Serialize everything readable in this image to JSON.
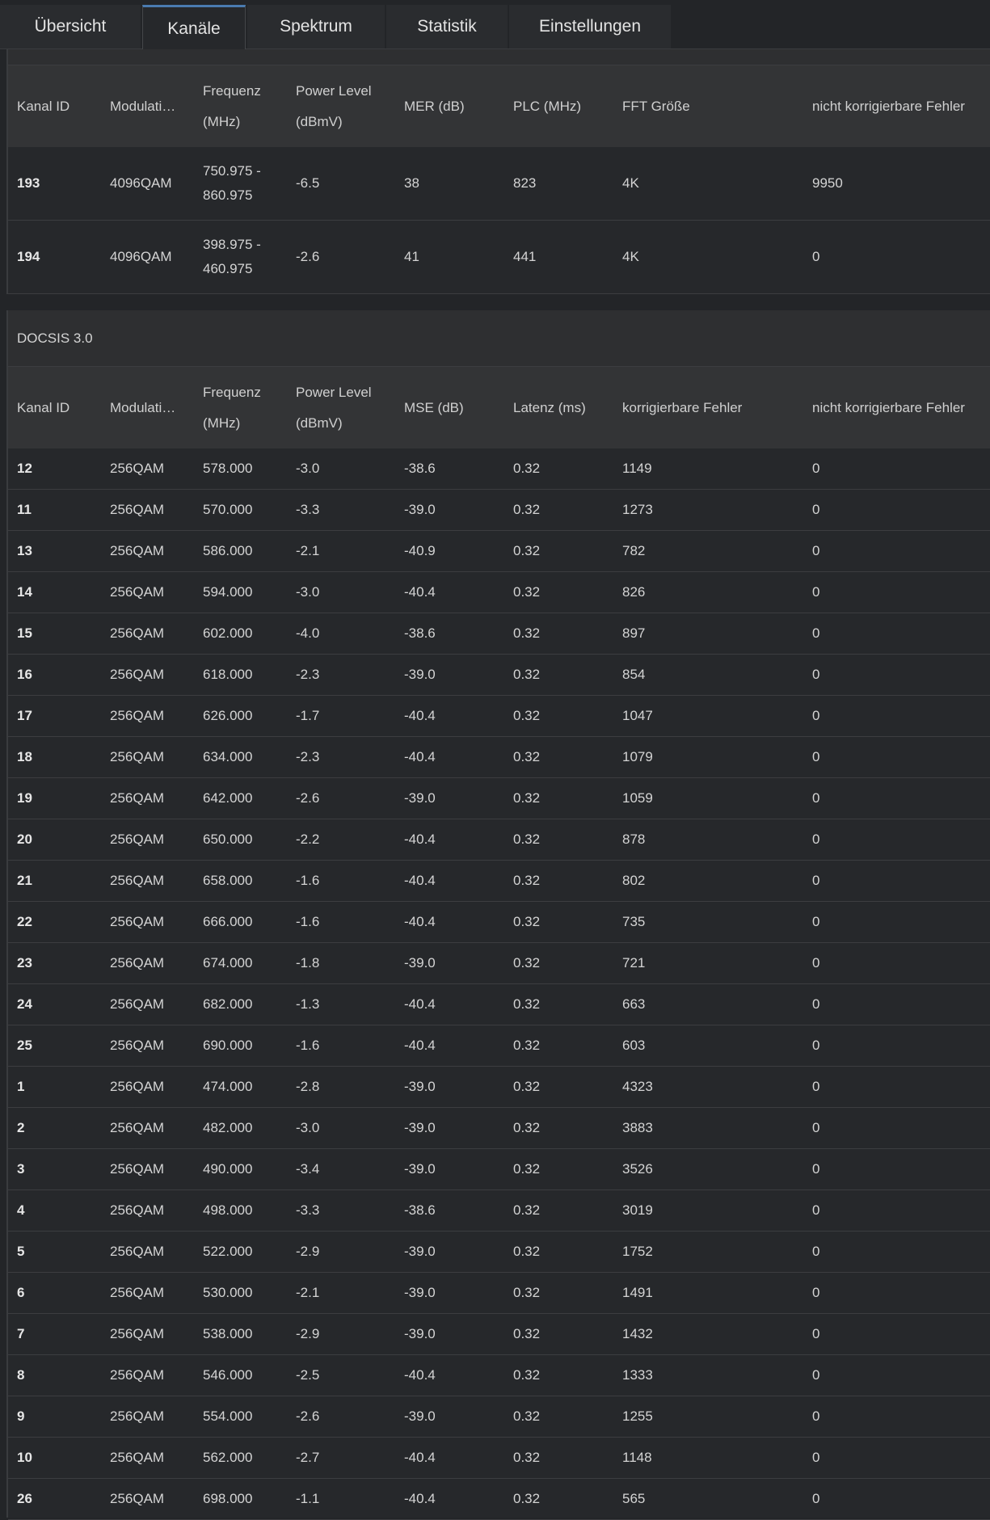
{
  "tabs": [
    "Übersicht",
    "Kanäle",
    "Spektrum",
    "Statistik",
    "Einstellungen"
  ],
  "active_tab": 1,
  "ofdm": {
    "title": "",
    "headers": [
      "Kanal ID",
      "Modulati…",
      "Frequenz (MHz)",
      "Power Level (dBmV)",
      "MER (dB)",
      "PLC (MHz)",
      "FFT Größe",
      "nicht korrigierbare Fehler"
    ],
    "rows": [
      [
        "193",
        "4096QAM",
        "750.975 - 860.975",
        "-6.5",
        "38",
        "823",
        "4K",
        "9950"
      ],
      [
        "194",
        "4096QAM",
        "398.975 - 460.975",
        "-2.6",
        "41",
        "441",
        "4K",
        "0"
      ]
    ]
  },
  "docsis30": {
    "title": "DOCSIS 3.0",
    "headers": [
      "Kanal ID",
      "Modulati…",
      "Frequenz (MHz)",
      "Power Level (dBmV)",
      "MSE (dB)",
      "Latenz (ms)",
      "korrigierbare Fehler",
      "nicht korrigierbare Fehler"
    ],
    "rows": [
      [
        "12",
        "256QAM",
        "578.000",
        "-3.0",
        "-38.6",
        "0.32",
        "1149",
        "0"
      ],
      [
        "11",
        "256QAM",
        "570.000",
        "-3.3",
        "-39.0",
        "0.32",
        "1273",
        "0"
      ],
      [
        "13",
        "256QAM",
        "586.000",
        "-2.1",
        "-40.9",
        "0.32",
        "782",
        "0"
      ],
      [
        "14",
        "256QAM",
        "594.000",
        "-3.0",
        "-40.4",
        "0.32",
        "826",
        "0"
      ],
      [
        "15",
        "256QAM",
        "602.000",
        "-4.0",
        "-38.6",
        "0.32",
        "897",
        "0"
      ],
      [
        "16",
        "256QAM",
        "618.000",
        "-2.3",
        "-39.0",
        "0.32",
        "854",
        "0"
      ],
      [
        "17",
        "256QAM",
        "626.000",
        "-1.7",
        "-40.4",
        "0.32",
        "1047",
        "0"
      ],
      [
        "18",
        "256QAM",
        "634.000",
        "-2.3",
        "-40.4",
        "0.32",
        "1079",
        "0"
      ],
      [
        "19",
        "256QAM",
        "642.000",
        "-2.6",
        "-39.0",
        "0.32",
        "1059",
        "0"
      ],
      [
        "20",
        "256QAM",
        "650.000",
        "-2.2",
        "-40.4",
        "0.32",
        "878",
        "0"
      ],
      [
        "21",
        "256QAM",
        "658.000",
        "-1.6",
        "-40.4",
        "0.32",
        "802",
        "0"
      ],
      [
        "22",
        "256QAM",
        "666.000",
        "-1.6",
        "-40.4",
        "0.32",
        "735",
        "0"
      ],
      [
        "23",
        "256QAM",
        "674.000",
        "-1.8",
        "-39.0",
        "0.32",
        "721",
        "0"
      ],
      [
        "24",
        "256QAM",
        "682.000",
        "-1.3",
        "-40.4",
        "0.32",
        "663",
        "0"
      ],
      [
        "25",
        "256QAM",
        "690.000",
        "-1.6",
        "-40.4",
        "0.32",
        "603",
        "0"
      ],
      [
        "1",
        "256QAM",
        "474.000",
        "-2.8",
        "-39.0",
        "0.32",
        "4323",
        "0"
      ],
      [
        "2",
        "256QAM",
        "482.000",
        "-3.0",
        "-39.0",
        "0.32",
        "3883",
        "0"
      ],
      [
        "3",
        "256QAM",
        "490.000",
        "-3.4",
        "-39.0",
        "0.32",
        "3526",
        "0"
      ],
      [
        "4",
        "256QAM",
        "498.000",
        "-3.3",
        "-38.6",
        "0.32",
        "3019",
        "0"
      ],
      [
        "5",
        "256QAM",
        "522.000",
        "-2.9",
        "-39.0",
        "0.32",
        "1752",
        "0"
      ],
      [
        "6",
        "256QAM",
        "530.000",
        "-2.1",
        "-39.0",
        "0.32",
        "1491",
        "0"
      ],
      [
        "7",
        "256QAM",
        "538.000",
        "-2.9",
        "-39.0",
        "0.32",
        "1432",
        "0"
      ],
      [
        "8",
        "256QAM",
        "546.000",
        "-2.5",
        "-40.4",
        "0.32",
        "1333",
        "0"
      ],
      [
        "9",
        "256QAM",
        "554.000",
        "-2.6",
        "-39.0",
        "0.32",
        "1255",
        "0"
      ],
      [
        "10",
        "256QAM",
        "562.000",
        "-2.7",
        "-40.4",
        "0.32",
        "1148",
        "0"
      ],
      [
        "26",
        "256QAM",
        "698.000",
        "-1.1",
        "-40.4",
        "0.32",
        "565",
        "0"
      ]
    ]
  }
}
